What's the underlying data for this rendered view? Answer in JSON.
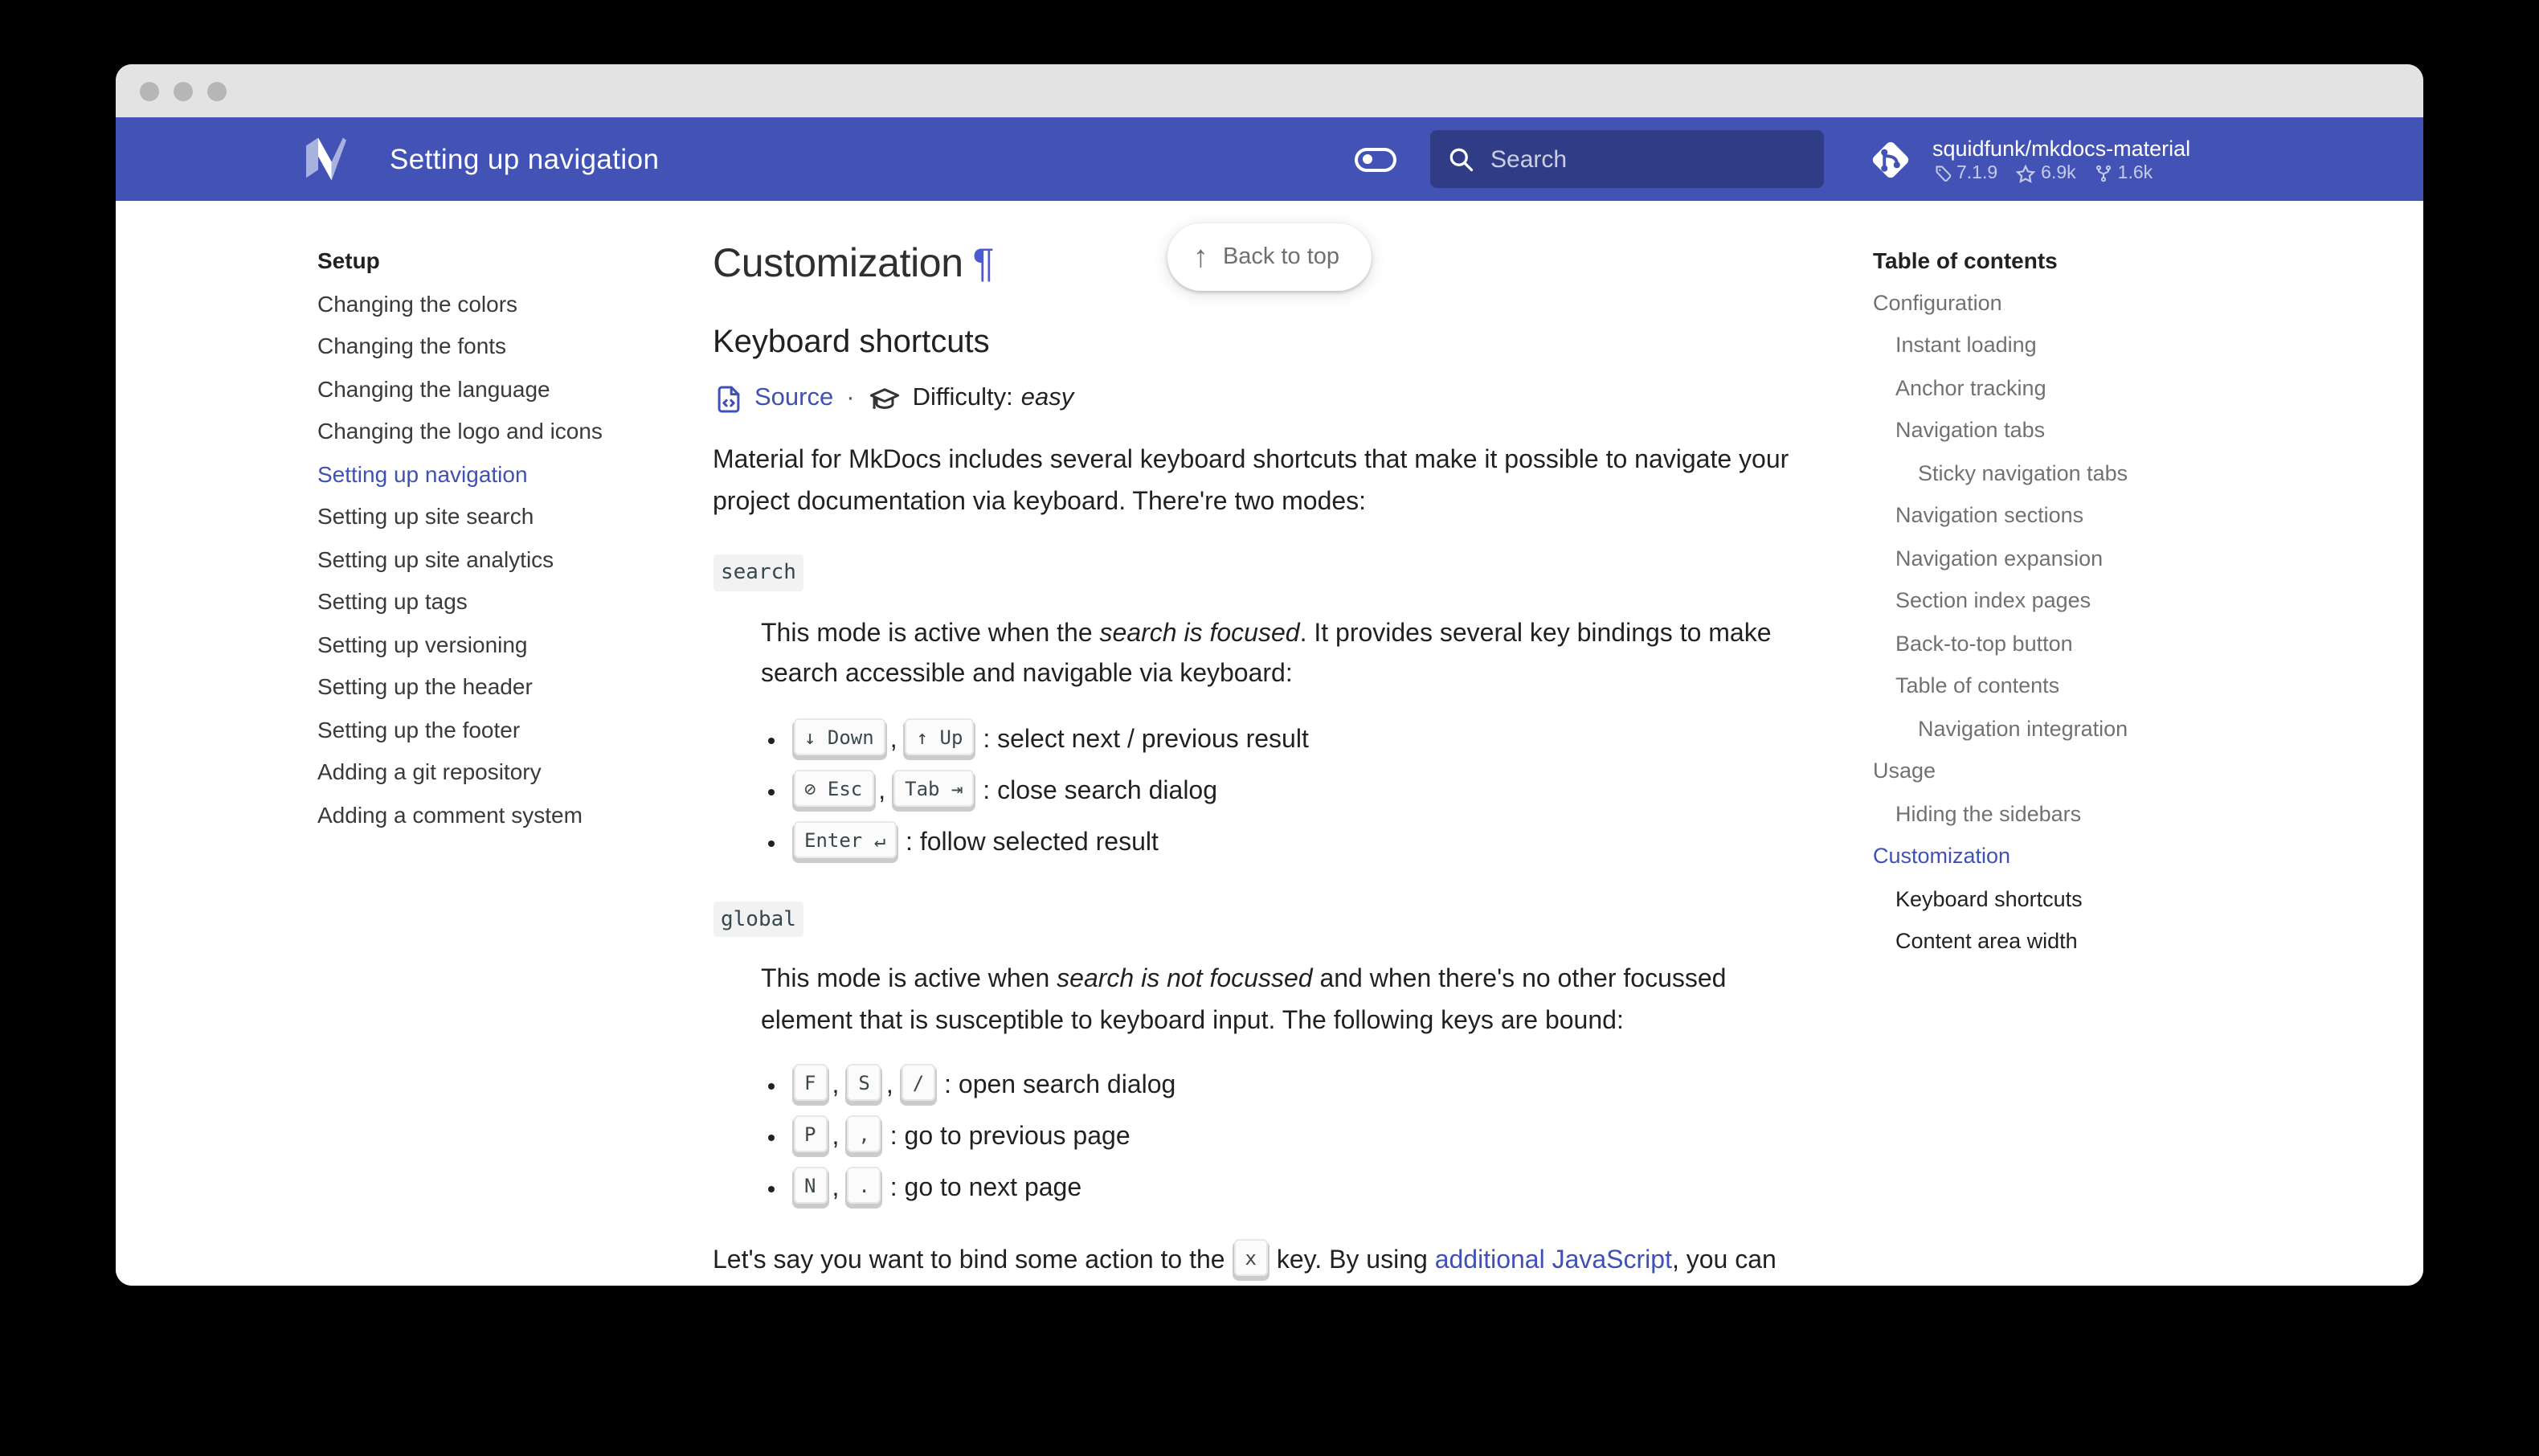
{
  "colors": {
    "accent": "#4051b5",
    "header": "#4253b5",
    "search_bg": "rgba(0,0,0,0.26)",
    "toc_muted": "#8a8a8a"
  },
  "window": {
    "controls": [
      "close",
      "minimize",
      "maximize"
    ]
  },
  "header": {
    "title": "Setting up navigation",
    "search": {
      "placeholder": "Search"
    },
    "repo": {
      "name": "squidfunk/mkdocs-material",
      "version": "7.1.9",
      "stars": "6.9k",
      "forks": "1.6k"
    }
  },
  "sidebar": {
    "section_label": "Setup",
    "items": [
      {
        "label": "Changing the colors",
        "active": false
      },
      {
        "label": "Changing the fonts",
        "active": false
      },
      {
        "label": "Changing the language",
        "active": false
      },
      {
        "label": "Changing the logo and icons",
        "active": false
      },
      {
        "label": "Setting up navigation",
        "active": true
      },
      {
        "label": "Setting up site search",
        "active": false
      },
      {
        "label": "Setting up site analytics",
        "active": false
      },
      {
        "label": "Setting up tags",
        "active": false
      },
      {
        "label": "Setting up versioning",
        "active": false
      },
      {
        "label": "Setting up the header",
        "active": false
      },
      {
        "label": "Setting up the footer",
        "active": false
      },
      {
        "label": "Adding a git repository",
        "active": false
      },
      {
        "label": "Adding a comment system",
        "active": false
      }
    ]
  },
  "main": {
    "back_to_top": "Back to top",
    "h1": "Customization",
    "pilcrow": "¶",
    "h2": "Keyboard shortcuts",
    "source_label": "Source",
    "separator": "·",
    "difficulty_label": "Difficulty:",
    "difficulty_value": "easy",
    "intro": "Material for MkDocs includes several keyboard shortcuts that make it possible to navigate your project documentation via keyboard. There're two modes:",
    "modes": [
      {
        "badge": "search",
        "desc_before": "This mode is active when the ",
        "desc_em": "search is focused",
        "desc_after": ". It provides several key bindings to make search accessible and navigable via keyboard:",
        "bindings": [
          {
            "keys": [
              "↓ Down",
              "↑ Up"
            ],
            "action": ": select next / previous result"
          },
          {
            "keys": [
              "⊘ Esc",
              "Tab ⇥"
            ],
            "action": ": close search dialog"
          },
          {
            "keys": [
              "Enter ↵"
            ],
            "action": ": follow selected result"
          }
        ]
      },
      {
        "badge": "global",
        "desc_before": "This mode is active when ",
        "desc_em": "search is not focussed",
        "desc_after": " and when there's no other focussed element that is susceptible to keyboard input. The following keys are bound:",
        "bindings": [
          {
            "keys": [
              "F",
              "S",
              "/"
            ],
            "action": ": open search dialog"
          },
          {
            "keys": [
              "P",
              ","
            ],
            "action": ": go to previous page"
          },
          {
            "keys": [
              "N",
              "."
            ],
            "action": ": go to next page"
          }
        ]
      }
    ],
    "outro": {
      "before": "Let's say you want to bind some action to the ",
      "key": "x",
      "mid": " key. By using ",
      "link": "additional JavaScript",
      "after": ", you can"
    }
  },
  "toc": {
    "title": "Table of contents",
    "items": [
      {
        "label": "Configuration",
        "level": 0,
        "state": "default"
      },
      {
        "label": "Instant loading",
        "level": 1,
        "state": "default"
      },
      {
        "label": "Anchor tracking",
        "level": 1,
        "state": "default"
      },
      {
        "label": "Navigation tabs",
        "level": 1,
        "state": "default"
      },
      {
        "label": "Sticky navigation tabs",
        "level": 2,
        "state": "default"
      },
      {
        "label": "Navigation sections",
        "level": 1,
        "state": "default"
      },
      {
        "label": "Navigation expansion",
        "level": 1,
        "state": "default"
      },
      {
        "label": "Section index pages",
        "level": 1,
        "state": "default"
      },
      {
        "label": "Back-to-top button",
        "level": 1,
        "state": "default"
      },
      {
        "label": "Table of contents",
        "level": 1,
        "state": "default"
      },
      {
        "label": "Navigation integration",
        "level": 2,
        "state": "default"
      },
      {
        "label": "Usage",
        "level": 0,
        "state": "default"
      },
      {
        "label": "Hiding the sidebars",
        "level": 1,
        "state": "default"
      },
      {
        "label": "Customization",
        "level": 0,
        "state": "active"
      },
      {
        "label": "Keyboard shortcuts",
        "level": 1,
        "state": "current"
      },
      {
        "label": "Content area width",
        "level": 1,
        "state": "current"
      }
    ]
  }
}
